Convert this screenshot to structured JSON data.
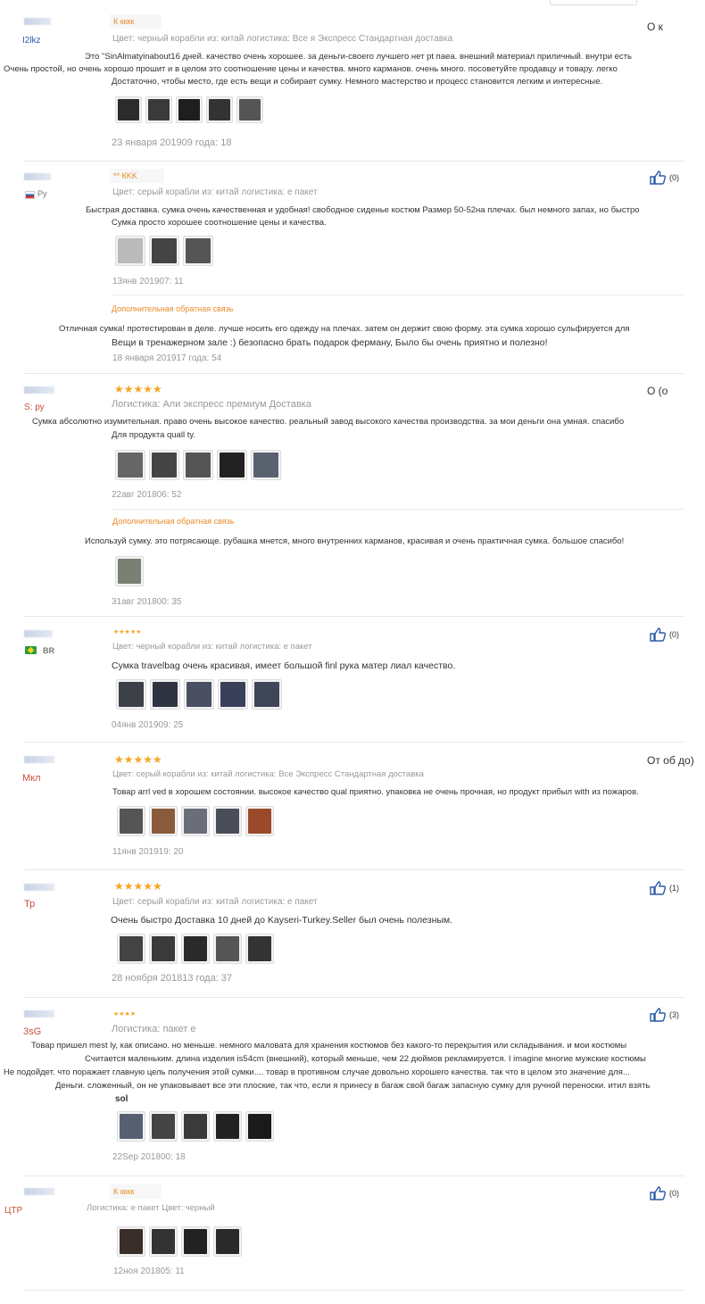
{
  "reviews": [
    {
      "user": "I2lkz",
      "label": "К кккк",
      "meta": "Цвет: черный корабли из: китай логистика: Все я Экспресс Стандартная доставка",
      "right": "О к",
      "lines": [
        "Это \"SinAlmatyinabout16 дней. качество очень хорошее. за деньги-своего лучшего нет pt паеа. внешний материал приличный. внутри есть",
        "Очень простой, но очень хорошо прошит и в целом это соотношение цены и качества. много карманов. очень много. посоветуйте продавцу и товару. легко",
        "Достаточно, чтобы место, где есть вещи и собирает сумку. Немного мастерство и процесс становится легким и интересные."
      ],
      "date": "23 января 201909 года: 18"
    },
    {
      "user": "Ру",
      "label": "** КKK",
      "meta": "Цвет: серый корабли из: китай логистика: е пакет",
      "likes": "(0)",
      "lines": [
        "Быстрая доставка. сумка очень качественная и удобная! свободное сиденье костюм Размер 50-52на плечах. был немного запах, но быстро",
        "Сумка просто хорошее соотношение цены и качества."
      ],
      "date": "13янв 201907: 11",
      "additional": "Дополнительная обратная связь",
      "addLines": [
        "Отличная сумка! протестирован в деле. лучше носить его одежду на плечах. затем он держит свою форму. эта сумка хорошо сульфируется для",
        "Вещи в тренажерном зале :) безопасно брать подарок ферману, Было бы очень приятно и полезно!"
      ],
      "addDate": "18 января 201917 года: 54"
    },
    {
      "user": "S: ру",
      "stars": "★★★★★",
      "meta": "Логистика: Али экспресс премиум Доставка",
      "right": "О (о",
      "lines": [
        "Сумка абсолютно изумительная. право очень высокое качество. реальный завод высокого качества производства. за мои деньги она умная. спасибо",
        "Для продукта quall ty."
      ],
      "date": "22авг 201806: 52",
      "additional": "Дополнительная обратная связь",
      "addLines": [
        "Используй сумку. это потрясающе. рубашка мнется, много внутренних карманов, красивая и очень практичная сумка. большое спасибо!"
      ],
      "addDate": "31авг 201800: 35"
    },
    {
      "user": "BR",
      "smallStars": "★★★★★",
      "meta": "Цвет: черный корабли из: китай логистика: е пакет",
      "likes": "(0)",
      "lines": [
        "Сумка travelbag очень красивая, имеет большой finl рука матер лиал качество."
      ],
      "date": "04янв 201909: 25"
    },
    {
      "user": "Мкл",
      "stars": "★★★★★",
      "meta": "Цвет: серый корабли из: китай логистика: Все Экспресс Стандартная доставка",
      "right": "От об до)",
      "lines": [
        "Товар arrl ved в хорошем состоянии. высокое качество qual приятно. упаковка не очень прочная, но продукт прибыл with из пожаров."
      ],
      "date": "11янв 201919: 20"
    },
    {
      "user": "Тр",
      "stars": "★★★★★",
      "meta": "Цвет: серый корабли из: китай логистика: е пакет",
      "likes": "(1)",
      "lines": [
        "Очень быстро Доставка 10 дней до Kayseri-Turkey.Seller был очень полезным."
      ],
      "date": "28 ноября 201813 года: 37"
    },
    {
      "user": "3sG",
      "smallStars": "★★★★",
      "meta": "Логистика: пакет е",
      "likes": "(3)",
      "lines": [
        "Товар пришел mest ly, как описано. но меньше. немного маловата для хранения костюмов без какого-то перекрытия или складывания. и мои костюмы",
        "Считается маленьким. длина изделия is54cm (внешний), который меньше, чем 22 дюймов рекламируется. I imagine многие мужские костюмы",
        "Не подойдет. что поражает главную цель получения этой сумки.... товар в противном случае довольно хорошего качества. так что в целом это значение для...",
        "Деньги. сложенный, он не упаковывает все эти плоские, так что, если я принесу в багаж свой багаж запасную сумку для ручной переноски. итил взять"
      ],
      "fragment": "sol",
      "date": "22Sep 201800: 18"
    },
    {
      "user": "ЦТР",
      "label": "К кккк",
      "meta": "Логистика: е пакет Цвет: черный",
      "likes": "(0)",
      "lines": [],
      "date": "12ноя 201805: 11"
    }
  ],
  "colors": {
    "accent_orange": "#f5a623",
    "link_blue": "#2a5aa8",
    "username_red": "#c8513a"
  }
}
